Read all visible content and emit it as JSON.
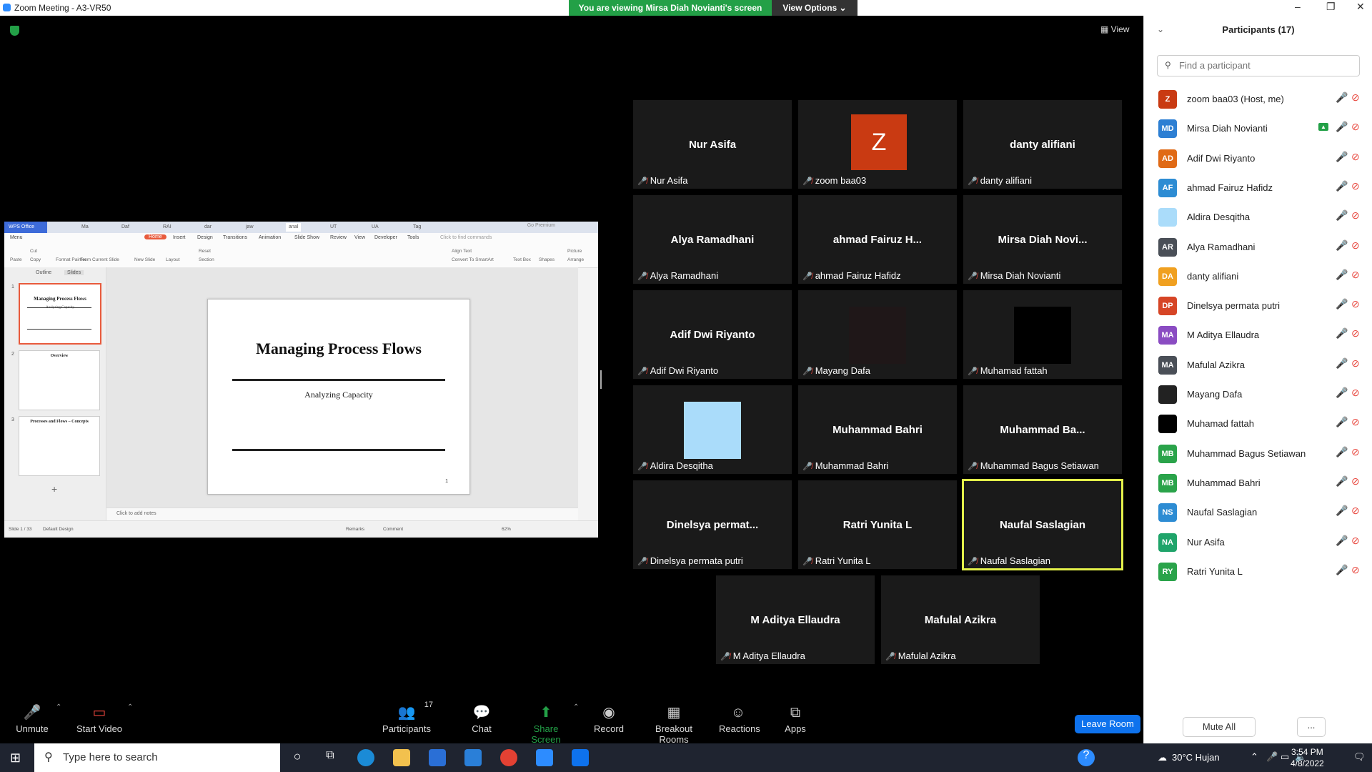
{
  "window": {
    "title": "Zoom Meeting - A3-VR50"
  },
  "banner": {
    "viewing_text": "You are viewing Mirsa Diah Novianti's screen",
    "view_options_label": "View Options ⌄"
  },
  "view_label": "View",
  "shared_screen": {
    "app_name": "WPS Office",
    "doc_tabs": [
      "Ma",
      "Daf",
      "RAI",
      "dar",
      "jaw",
      "anal",
      "UT",
      "UA",
      "Tag"
    ],
    "go_premium": "Go Premium",
    "menu_label": "Menu",
    "menu_tabs": [
      "Home",
      "Insert",
      "Design",
      "Transitions",
      "Animation",
      "Slide Show",
      "Review",
      "View",
      "Developer",
      "Tools"
    ],
    "find_placeholder": "Click to find commands",
    "ribbon": [
      "Paste",
      "Cut",
      "Copy",
      "Format Painter",
      "From Current Slide",
      "New Slide",
      "Layout",
      "Reset",
      "Section",
      "Align Text",
      "Convert To SmartArt",
      "Text Box",
      "Shapes",
      "Picture",
      "Arrange"
    ],
    "side_tabs": {
      "outline": "Outline",
      "slides": "Slides"
    },
    "thumbnails": [
      {
        "num": "1",
        "title": "Managing Process Flows",
        "sub": "Analyzing Capacity"
      },
      {
        "num": "2",
        "title": "Overview",
        "sub": ""
      },
      {
        "num": "3",
        "title": "Processes and Flows – Concepts",
        "sub": ""
      }
    ],
    "slide": {
      "title": "Managing Process Flows",
      "subtitle": "Analyzing Capacity",
      "page_number": "1"
    },
    "notes_placeholder": "Click to add notes",
    "status": {
      "slide_counter": "Slide 1 / 33",
      "design": "Default Design",
      "remarks": "Remarks",
      "comment": "Comment",
      "zoom": "62%"
    }
  },
  "tiles": [
    {
      "display": "Nur Asifa",
      "caption": "Nur Asifa",
      "kind": "name"
    },
    {
      "display": "Z",
      "caption": "zoom baa03",
      "kind": "avatar"
    },
    {
      "display": "danty alifiani",
      "caption": "danty alifiani",
      "kind": "name"
    },
    {
      "display": "Alya Ramadhani",
      "caption": "Alya Ramadhani",
      "kind": "name"
    },
    {
      "display": "ahmad Fairuz H...",
      "caption": "ahmad Fairuz Hafidz",
      "kind": "name"
    },
    {
      "display": "Mirsa Diah Novi...",
      "caption": "Mirsa Diah Novianti",
      "kind": "name"
    },
    {
      "display": "Adif Dwi Riyanto",
      "caption": "Adif Dwi Riyanto",
      "kind": "name"
    },
    {
      "display": "",
      "caption": "Mayang Dafa",
      "kind": "dark-block",
      "color": "#1f1718"
    },
    {
      "display": "",
      "caption": "Muhamad fattah",
      "kind": "black-block",
      "color": "#000000"
    },
    {
      "display": "",
      "caption": "Aldira Desqitha",
      "kind": "blue-block",
      "color": "#aadcfa"
    },
    {
      "display": "Muhammad Bahri",
      "caption": "Muhammad Bahri",
      "kind": "name"
    },
    {
      "display": "Muhammad Ba...",
      "caption": "Muhammad Bagus Setiawan",
      "kind": "name"
    },
    {
      "display": "Dinelsya permat...",
      "caption": "Dinelsya permata putri",
      "kind": "name"
    },
    {
      "display": "Ratri Yunita L",
      "caption": "Ratri Yunita L",
      "kind": "name"
    },
    {
      "display": "Naufal Saslagian",
      "caption": "Naufal Saslagian",
      "kind": "name",
      "active": true
    },
    {
      "display": "M Aditya Ellaudra",
      "caption": "M Aditya Ellaudra",
      "kind": "name"
    },
    {
      "display": "Mafulal Azikra",
      "caption": "Mafulal Azikra",
      "kind": "name"
    }
  ],
  "participants_panel": {
    "title": "Participants (17)",
    "search_placeholder": "Find a participant",
    "list": [
      {
        "initials": "Z",
        "name": "zoom baa03 (Host, me)",
        "color": "#c93a12"
      },
      {
        "initials": "MD",
        "name": "Mirsa Diah Novianti",
        "color": "#2d7fd3",
        "sharing": true
      },
      {
        "initials": "AD",
        "name": "Adif Dwi Riyanto",
        "color": "#e06a16"
      },
      {
        "initials": "AF",
        "name": "ahmad Fairuz Hafidz",
        "color": "#2d8cd3"
      },
      {
        "initials": "",
        "name": "Aldira Desqitha",
        "color": "#aadcfa"
      },
      {
        "initials": "AR",
        "name": "Alya Ramadhani",
        "color": "#4a4f57"
      },
      {
        "initials": "DA",
        "name": "danty alifiani",
        "color": "#f0a020"
      },
      {
        "initials": "DP",
        "name": "Dinelsya permata putri",
        "color": "#d64526"
      },
      {
        "initials": "MA",
        "name": "M Aditya Ellaudra",
        "color": "#8a4cc2"
      },
      {
        "initials": "MA",
        "name": "Mafulal Azikra",
        "color": "#4a4f57"
      },
      {
        "initials": "",
        "name": "Mayang Dafa",
        "color": "#222222"
      },
      {
        "initials": "",
        "name": "Muhamad fattah",
        "color": "#000000"
      },
      {
        "initials": "MB",
        "name": "Muhammad Bagus Setiawan",
        "color": "#2aa34a"
      },
      {
        "initials": "MB",
        "name": "Muhammad Bahri",
        "color": "#2aa34a"
      },
      {
        "initials": "NS",
        "name": "Naufal Saslagian",
        "color": "#2d8cd3"
      },
      {
        "initials": "NA",
        "name": "Nur Asifa",
        "color": "#1fa46a"
      },
      {
        "initials": "RY",
        "name": "Ratri Yunita L",
        "color": "#2aa34a"
      }
    ],
    "mute_all_label": "Mute All",
    "more_label": "..."
  },
  "toolbar": {
    "unmute": "Unmute",
    "start_video": "Start Video",
    "participants": "Participants",
    "participants_count": "17",
    "chat": "Chat",
    "share_screen": "Share Screen",
    "record": "Record",
    "breakout_rooms": "Breakout Rooms",
    "reactions": "Reactions",
    "apps": "Apps",
    "leave_room": "Leave Room"
  },
  "taskbar": {
    "search_placeholder": "Type here to search",
    "weather": "30°C  Hujan",
    "time": "3:54 PM",
    "date": "4/8/2022"
  }
}
